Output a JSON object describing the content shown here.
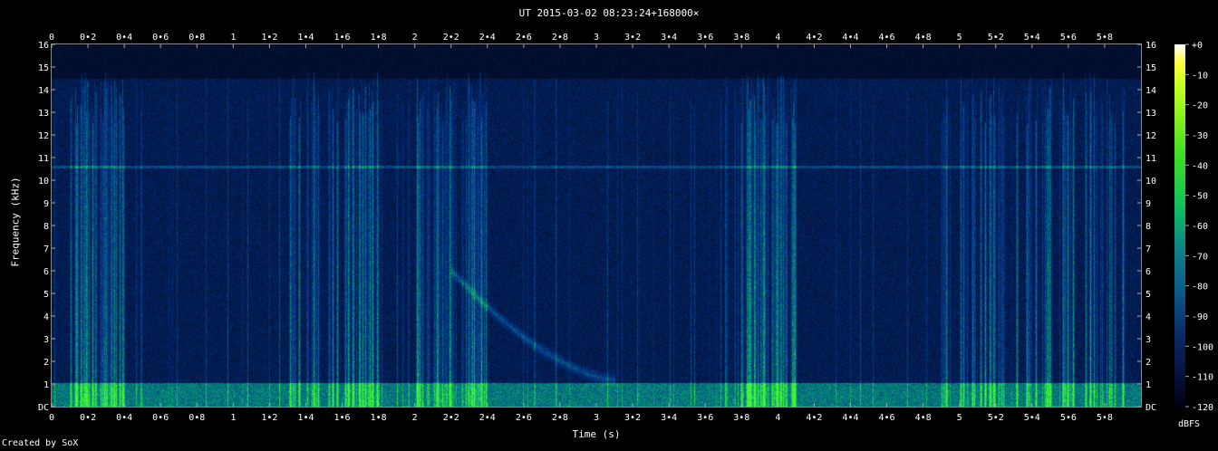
{
  "chart_data": {
    "type": "heatmap",
    "title": "UT 2015-03-02 08:23:24+168000×",
    "xlabel": "Time (s)",
    "ylabel": "Frequency (kHz)",
    "xlim": [
      0,
      6.0
    ],
    "ylim": [
      0,
      16
    ],
    "x_ticks": [
      "0",
      "0•2",
      "0•4",
      "0•6",
      "0•8",
      "1",
      "1•2",
      "1•4",
      "1•6",
      "1•8",
      "2",
      "2•2",
      "2•4",
      "2•6",
      "2•8",
      "3",
      "3•2",
      "3•4",
      "3•6",
      "3•8",
      "4",
      "4•2",
      "4•4",
      "4•6",
      "4•8",
      "5",
      "5•2",
      "5•4",
      "5•6",
      "5•8"
    ],
    "y_ticks": [
      "DC",
      "1",
      "2",
      "3",
      "4",
      "5",
      "6",
      "7",
      "8",
      "9",
      "10",
      "11",
      "12",
      "13",
      "14",
      "15",
      "16"
    ],
    "colorbar": {
      "label": "dBFS",
      "ticks": [
        "+0",
        "-10",
        "-20",
        "-30",
        "-40",
        "-50",
        "-60",
        "-70",
        "-80",
        "-90",
        "-100",
        "-110",
        "-120"
      ],
      "range": [
        -120,
        0
      ]
    },
    "features": {
      "horizontal_line_khz": 10.6,
      "low_band_khz": [
        0,
        1.1
      ],
      "noise_ceiling_khz": 14.5,
      "whistler_decay": {
        "t_start_s": 2.2,
        "f_start_khz": 6.0,
        "t_end_s": 3.1,
        "f_end_khz": 1.2
      },
      "sferic_clusters_s": [
        [
          0.1,
          0.4
        ],
        [
          1.3,
          1.8
        ],
        [
          2.0,
          2.4
        ],
        [
          3.8,
          4.1
        ],
        [
          4.9,
          5.95
        ]
      ]
    },
    "grid": false
  },
  "footer": {
    "created_by": "Created by SoX"
  }
}
